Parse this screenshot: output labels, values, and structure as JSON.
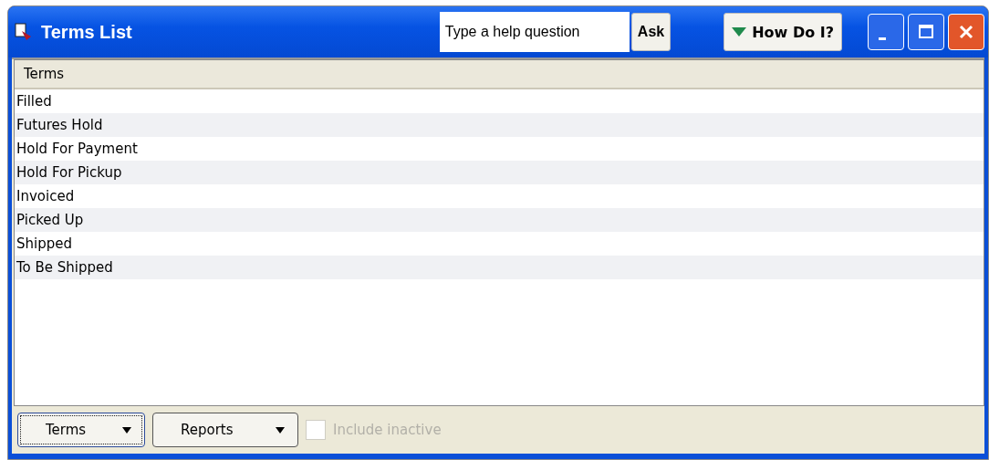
{
  "window": {
    "title": "Terms List"
  },
  "help": {
    "placeholder": "Type a help question",
    "ask": "Ask",
    "how_do_i": "How Do I?"
  },
  "table": {
    "columns": [
      "Terms"
    ],
    "rows": [
      {
        "term": "Filled"
      },
      {
        "term": "Futures Hold"
      },
      {
        "term": "Hold For Payment"
      },
      {
        "term": "Hold For Pickup"
      },
      {
        "term": "Invoiced"
      },
      {
        "term": "Picked Up"
      },
      {
        "term": "Shipped"
      },
      {
        "term": "To Be Shipped"
      }
    ]
  },
  "footer": {
    "buttons": [
      {
        "label": "Terms",
        "focused": true
      },
      {
        "label": "Reports",
        "focused": false
      }
    ],
    "include_inactive": {
      "label": "Include inactive",
      "checked": false,
      "disabled": true
    }
  }
}
